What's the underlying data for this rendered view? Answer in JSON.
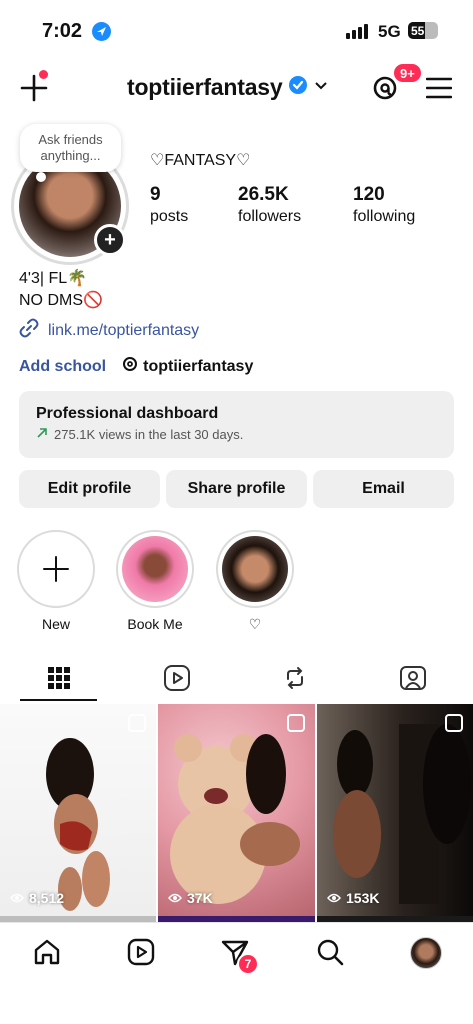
{
  "status_bar": {
    "time": "7:02",
    "network": "5G",
    "battery": "55",
    "battery_level": 0.55
  },
  "header": {
    "username": "toptiierfantasy",
    "notification_badge": "9+",
    "verified": true
  },
  "profile": {
    "note_text": "Ask friends anything...",
    "display_name": "♡FANTASY♡",
    "stats": [
      {
        "value": "9",
        "label": "posts"
      },
      {
        "value": "26.5K",
        "label": "followers"
      },
      {
        "value": "120",
        "label": "following"
      }
    ],
    "bio_line1": "4'3| FL🌴",
    "bio_line2": "NO DMS🚫",
    "link": "link.me/toptierfantasy",
    "add_school": "Add school",
    "threads_handle": "toptiierfantasy"
  },
  "dashboard": {
    "title": "Professional dashboard",
    "subtitle": "275.1K views in the last 30 days."
  },
  "actions": {
    "edit": "Edit profile",
    "share": "Share profile",
    "email": "Email"
  },
  "highlights": [
    {
      "label": "New"
    },
    {
      "label": "Book Me"
    },
    {
      "label": "♡"
    }
  ],
  "posts": [
    {
      "views": "8,512"
    },
    {
      "views": "37K"
    },
    {
      "views": "153K"
    }
  ],
  "bottom_nav": {
    "messages_badge": "7"
  },
  "colors": {
    "accent_blue": "#3a55a0",
    "badge_red": "#ff2d55",
    "verified_blue": "#1a8cff"
  }
}
